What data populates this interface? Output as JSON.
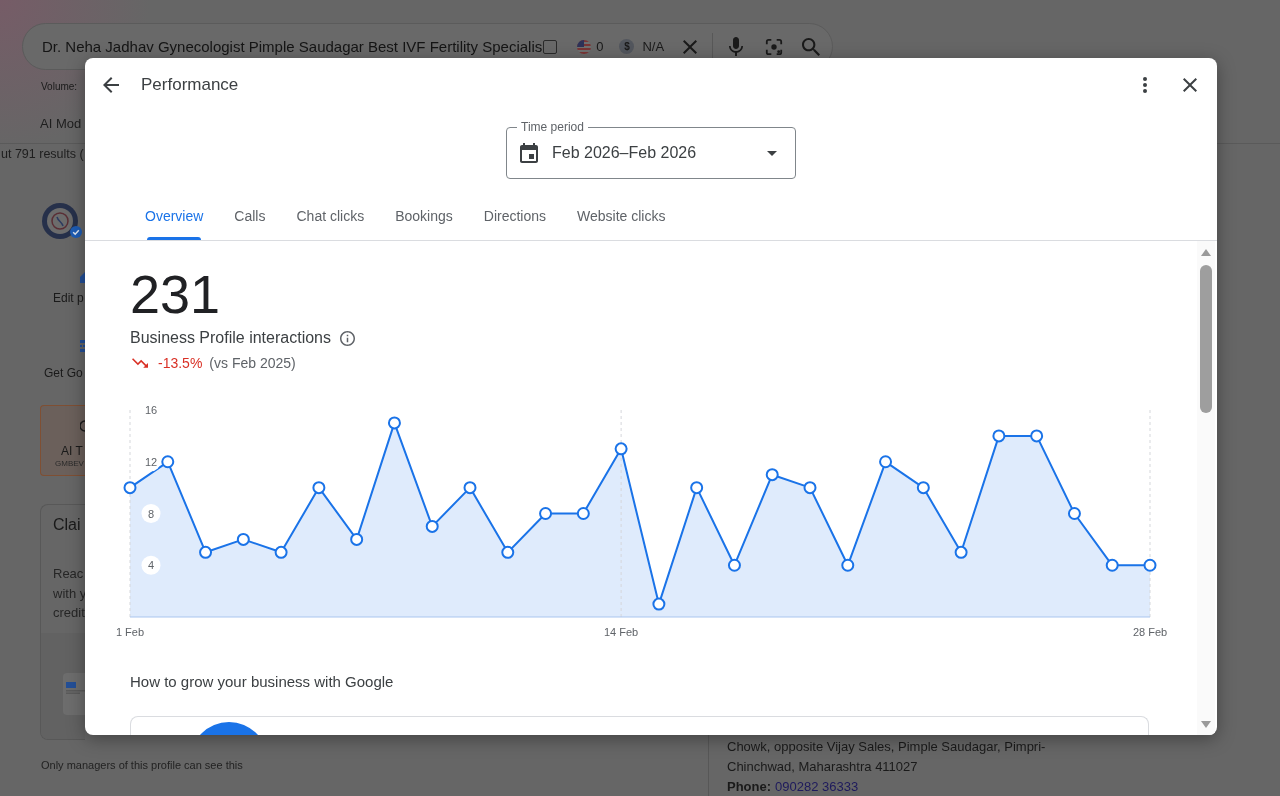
{
  "background_page": {
    "search_bar": {
      "query": "Dr. Neha Jadhav Gynecologist Pimple Saudagar Best IVF Fertility Specialis",
      "checked": false,
      "flag_count": "0",
      "currency_symbol": "$",
      "price": "N/A"
    },
    "volume_label": "Volume:",
    "mode_tab": "AI Mod",
    "results_count": "ut 791 results (",
    "profile_actions": [
      {
        "label": "Edit p",
        "kind": "pencil"
      },
      {
        "label": "Get Go",
        "kind": "grid"
      }
    ],
    "ai_card": {
      "title": "AI T",
      "code": "GMBEV"
    },
    "claim_card": {
      "title": "Clai",
      "lines": [
        "Reac",
        "with y",
        "credit"
      ]
    },
    "managers_note": "Only managers of this profile can see this",
    "address_lines": [
      "Chowk, opposite Vijay Sales, Pimple Saudagar, Pimpri-",
      "Chinchwad, Maharashtra 411027"
    ],
    "phone": {
      "label": "Phone:",
      "number": "090282 36333"
    }
  },
  "dialog": {
    "title": "Performance",
    "time_period": {
      "label": "Time period",
      "value": "Feb 2026–Feb 2026"
    },
    "tabs": [
      {
        "label": "Overview",
        "selected": true
      },
      {
        "label": "Calls",
        "selected": false
      },
      {
        "label": "Chat clicks",
        "selected": false
      },
      {
        "label": "Bookings",
        "selected": false
      },
      {
        "label": "Directions",
        "selected": false
      },
      {
        "label": "Website clicks",
        "selected": false
      }
    ],
    "metric": {
      "value": "231",
      "label": "Business Profile interactions",
      "declining": true,
      "change": "-13.5%",
      "comparison": "(vs Feb 2025)"
    },
    "chart_data": {
      "type": "area",
      "categories": [
        "1 Feb",
        null,
        null,
        null,
        null,
        null,
        null,
        null,
        null,
        null,
        null,
        null,
        null,
        "14 Feb",
        null,
        null,
        null,
        null,
        null,
        null,
        null,
        null,
        null,
        null,
        null,
        null,
        null,
        "28 Feb"
      ],
      "series": [
        {
          "color": "#1a73e8",
          "values": [
            10,
            12,
            5,
            6,
            5,
            10,
            6,
            15,
            7,
            10,
            5,
            8,
            8,
            13,
            1,
            10,
            4,
            11,
            10,
            4,
            12,
            10,
            5,
            14,
            14,
            8,
            4,
            4
          ]
        }
      ],
      "ylim": [
        0,
        16
      ],
      "yticks": [
        4,
        8,
        12,
        16
      ]
    },
    "section_title": "How to grow your business with Google"
  }
}
